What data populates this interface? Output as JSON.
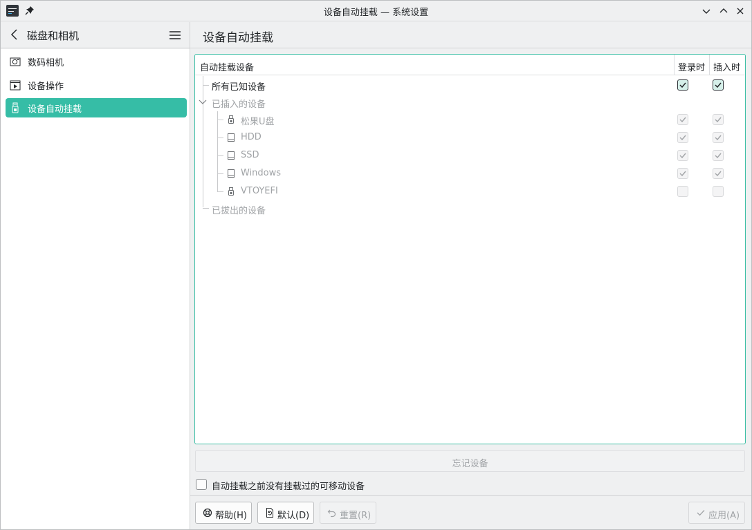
{
  "window": {
    "title": "设备自动挂载 — 系统设置"
  },
  "sidebar": {
    "title": "磁盘和相机",
    "items": [
      {
        "label": "数码相机",
        "icon": "camera-icon",
        "active": false
      },
      {
        "label": "设备操作",
        "icon": "device-actions-icon",
        "active": false
      },
      {
        "label": "设备自动挂载",
        "icon": "usb-drive-icon",
        "active": true
      }
    ]
  },
  "main": {
    "title": "设备自动挂载",
    "tree": {
      "columns": [
        "自动挂载设备",
        "登录时",
        "插入时"
      ],
      "all_known": {
        "label": "所有已知设备",
        "login": true,
        "insert": true
      },
      "attached_group": "已插入的设备",
      "devices": [
        {
          "label": "松果U盘",
          "icon": "usb-drive-icon",
          "login": true,
          "insert": true
        },
        {
          "label": "HDD",
          "icon": "hard-drive-icon",
          "login": true,
          "insert": true
        },
        {
          "label": "SSD",
          "icon": "hard-drive-icon",
          "login": true,
          "insert": true
        },
        {
          "label": "Windows",
          "icon": "hard-drive-icon",
          "login": true,
          "insert": true
        },
        {
          "label": "VTOYEFI",
          "icon": "usb-drive-icon",
          "login": false,
          "insert": false
        }
      ],
      "detached_group": "已拔出的设备"
    },
    "forget_button": "忘记设备",
    "automount_new_label": "自动挂载之前没有挂载过的可移动设备",
    "automount_new_checked": false
  },
  "footer": {
    "help": "帮助(H)",
    "defaults": "默认(D)",
    "reset": "重置(R)",
    "apply": "应用(A)"
  },
  "colors": {
    "accent": "#36bda6",
    "text": "#232629",
    "disabled_text": "#a0a3a6"
  }
}
